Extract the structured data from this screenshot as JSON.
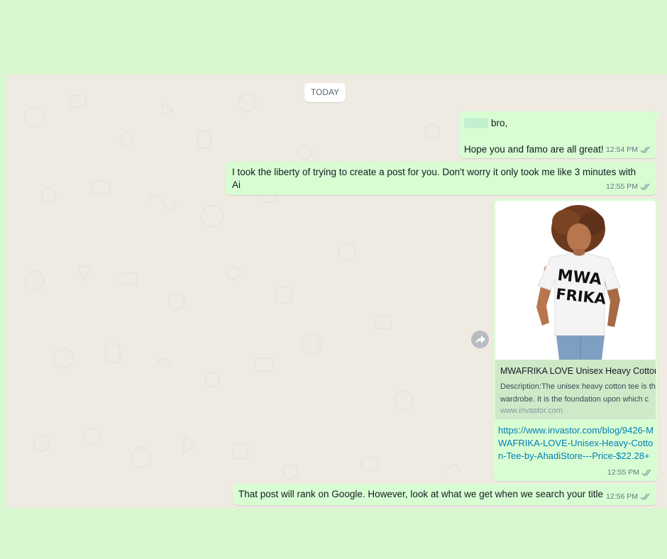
{
  "chat": {
    "date_divider": "TODAY",
    "messages": [
      {
        "line1": "bro,",
        "line2": "Hope you and famo are all great!",
        "time": "12:54 PM"
      },
      {
        "line1": "I took the liberty of trying to create a post for you. Don't worry it only took me like 3 minutes with",
        "line2": "Ai",
        "time": "12:55 PM"
      },
      {
        "shirt_text_1": "MWA",
        "shirt_text_2": "FRIKA",
        "preview_title": "MWAFRIKA LOVE Unisex Heavy Cotton T",
        "preview_desc_1": "Description:The unisex heavy cotton tee is th",
        "preview_desc_2": "wardrobe. It is the foundation upon which c",
        "preview_domain": "www.invastor.com",
        "link": "https://www.invastor.com/blog/9426-MWAFRIKA-LOVE-Unisex-Heavy-Cotton-Tee-by-AhadiStore---Price-$22.28+",
        "time": "12:55 PM"
      },
      {
        "text": "That post will rank on Google. However, look at  what we get when we search your title",
        "time": "12:56 PM"
      }
    ]
  },
  "icons": {
    "forward": "forward-icon",
    "read_receipt": "double-check-icon"
  },
  "colors": {
    "page_bg": "#d9f7d1",
    "chat_bg": "#efeae2",
    "outgoing_bubble": "#d9fdd3",
    "link": "#027eb5",
    "read_ticks": "#8696a0"
  }
}
